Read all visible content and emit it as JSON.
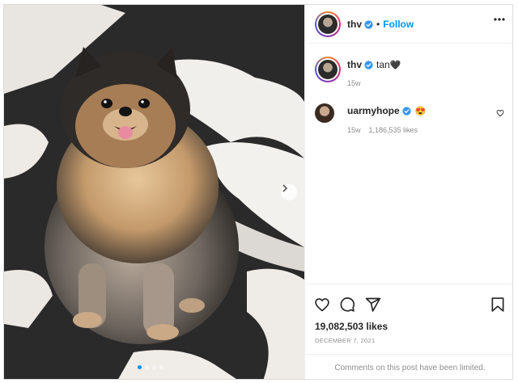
{
  "post": {
    "author": "thv",
    "follow_label": "Follow",
    "separator": "•",
    "caption_text": "tan",
    "caption_emoji": "🖤",
    "caption_age": "15w",
    "likes": "19,082,503 likes",
    "date": "DECEMBER 7, 2021",
    "comments_notice": "Comments on this post have been limited.",
    "carousel": {
      "slides": 4,
      "active_index": 0
    }
  },
  "comments": [
    {
      "username": "uarmyhope",
      "text": "😍",
      "age": "15w",
      "likes": "1,186,535 likes"
    }
  ],
  "icons": {
    "verified": "verified-badge-icon",
    "more": "more-options-icon",
    "heart": "heart-icon",
    "comment": "comment-icon",
    "share": "share-icon",
    "save": "bookmark-icon",
    "next": "chevron-right-icon"
  },
  "colors": {
    "accent": "#0095f6",
    "verified": "#3897f0",
    "muted": "#8e8e8e"
  }
}
